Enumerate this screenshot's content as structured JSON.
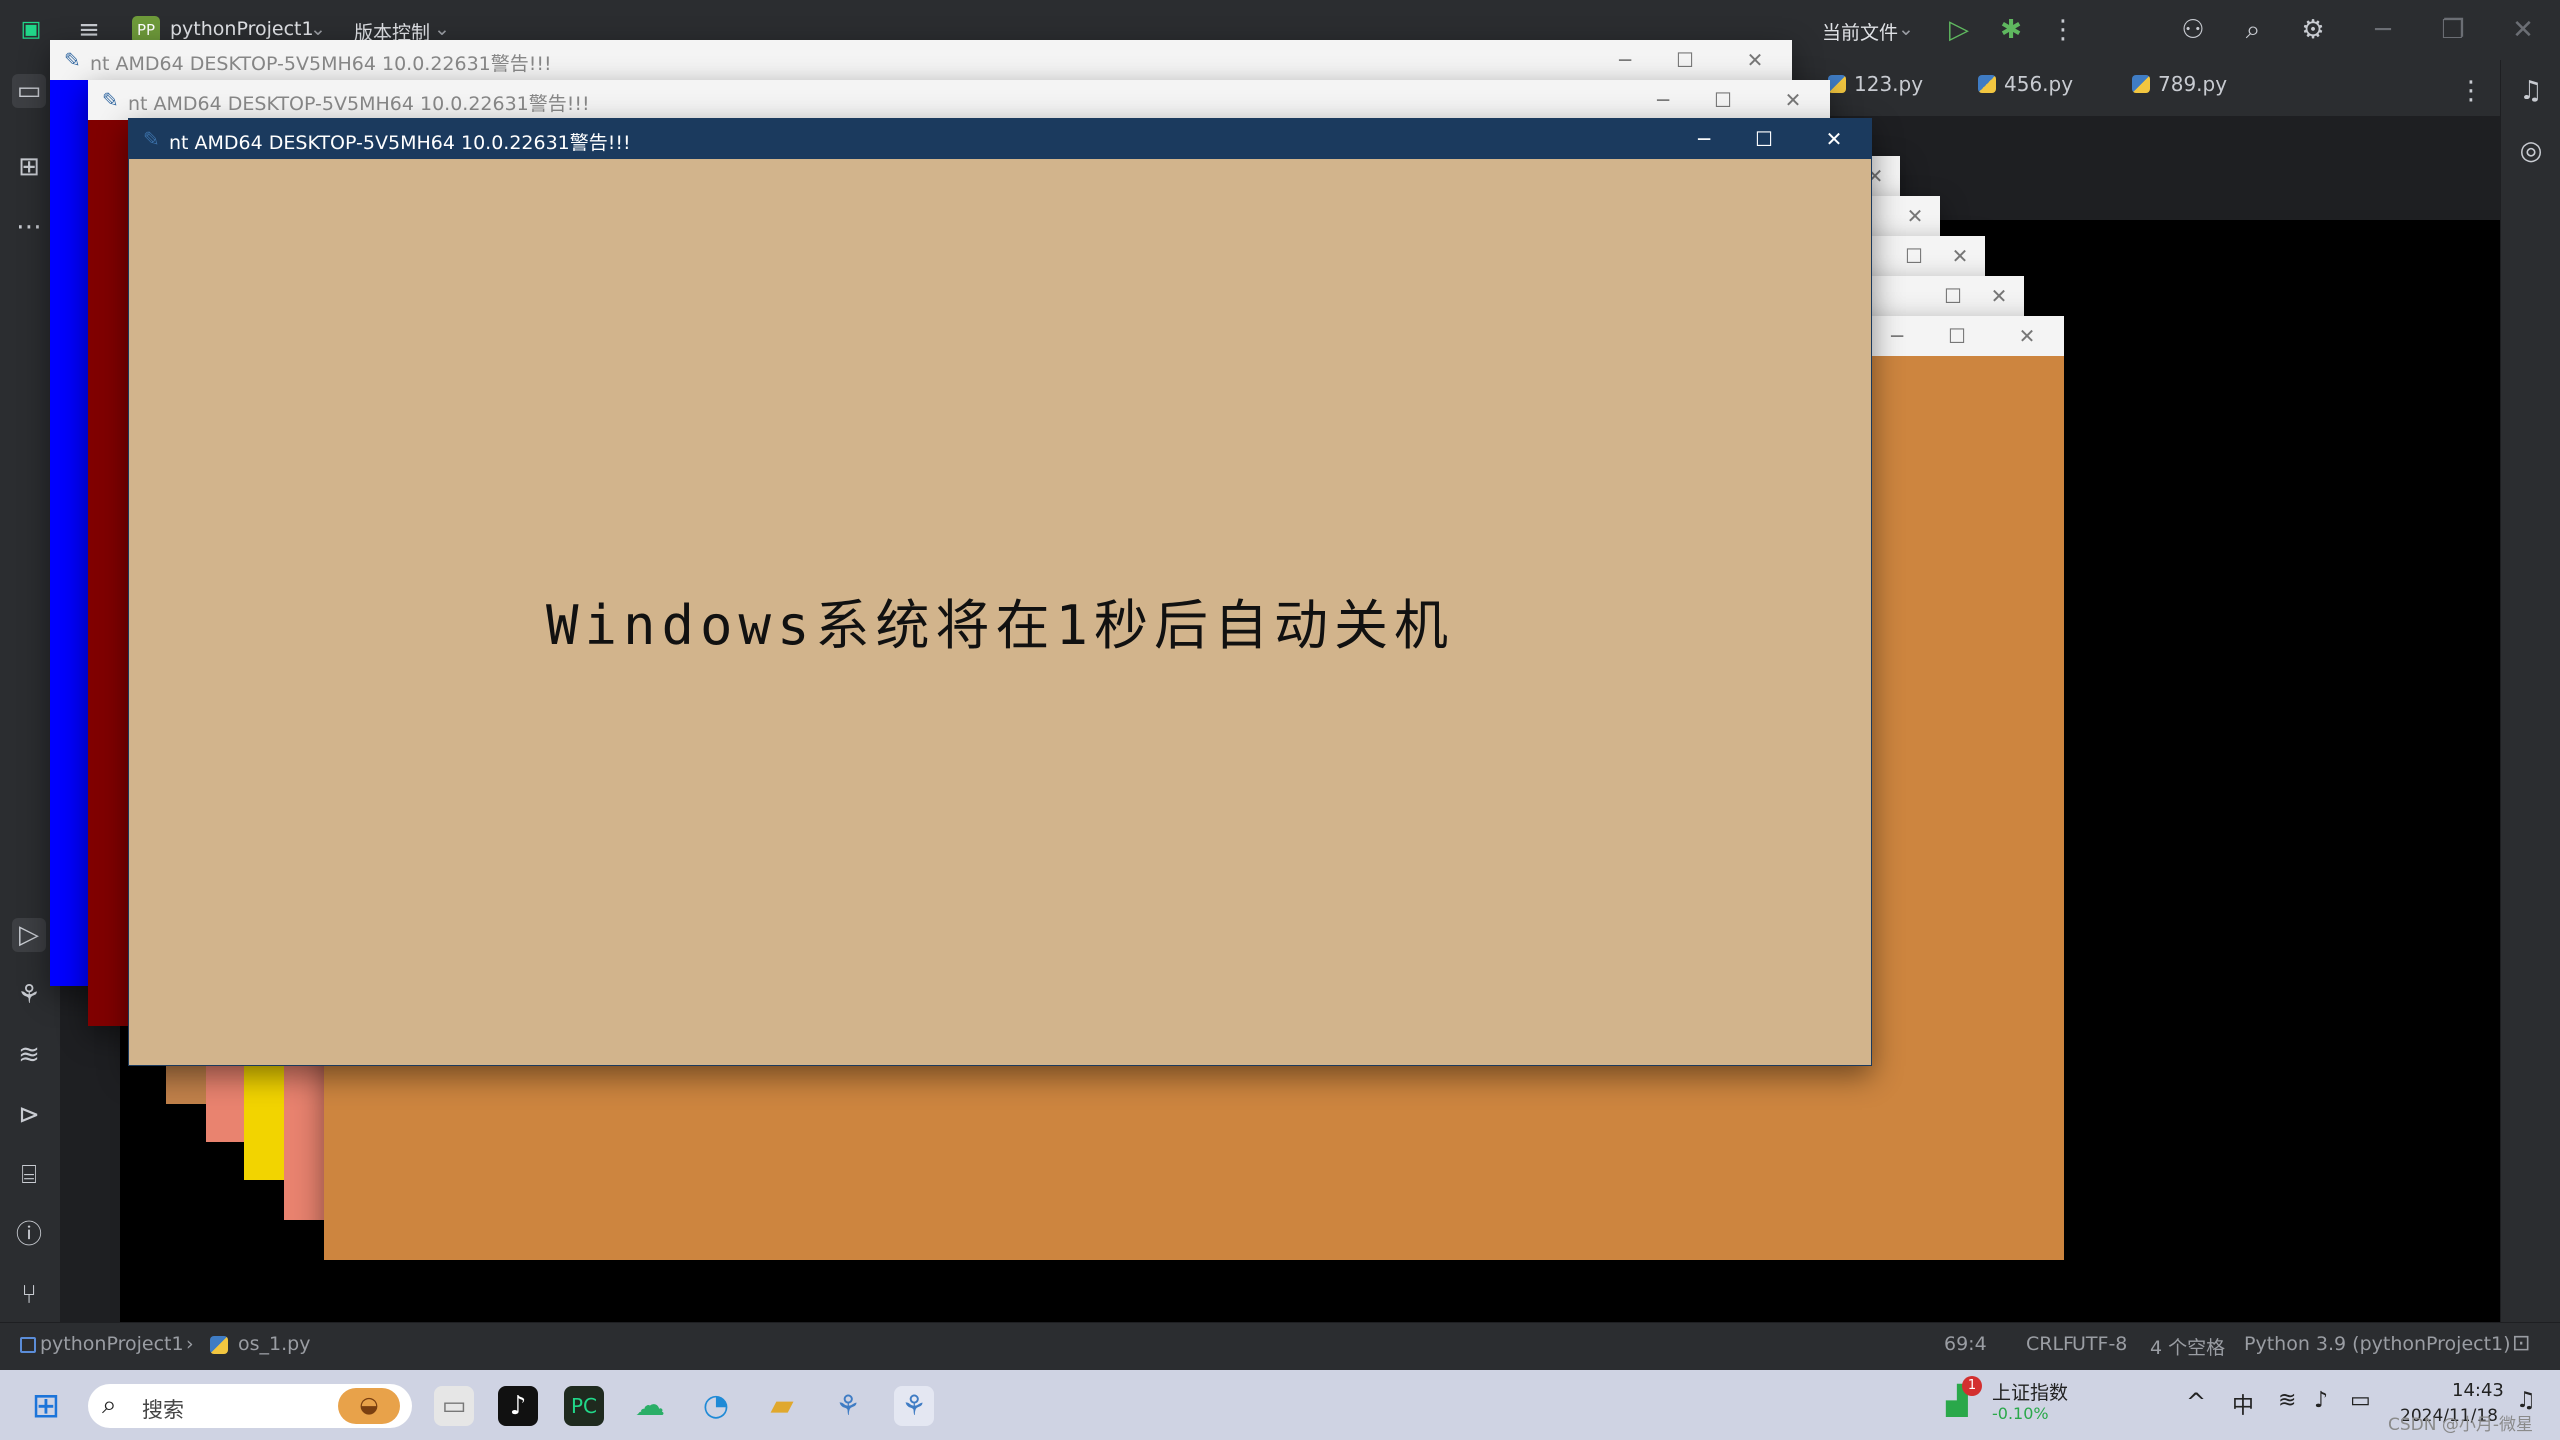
{
  "ide": {
    "project_name": "pythonProject1",
    "project_badge": "PP",
    "vcs_label": "版本控制",
    "run_config": "当前文件",
    "tabs": [
      {
        "label": "123.py"
      },
      {
        "label": "456.py"
      },
      {
        "label": "789.py"
      }
    ],
    "breadcrumb": {
      "project": "pythonProject1",
      "file": "os_1.py"
    },
    "status": {
      "position": "69:4",
      "line_sep": "CRLF",
      "encoding": "UTF-8",
      "indent": "4 个空格",
      "interpreter": "Python 3.9 (pythonProject1)"
    }
  },
  "popup": {
    "title": "nt AMD64 DESKTOP-5V5MH64 10.0.22631警告!!!",
    "message": "Windows系统将在1秒后自动关机",
    "minimize": "─",
    "maximize": "☐",
    "close": "✕",
    "colors": {
      "active_bg": "#d2b48c",
      "blue": "#0000ff",
      "darkred": "#800000",
      "orange": "#cd853f",
      "salmon": "#e9836f",
      "yellow": "#f2d400",
      "peru": "#c1814a"
    }
  },
  "taskbar": {
    "search_placeholder": "搜索",
    "stock_name": "上证指数",
    "stock_change": "-0.10%",
    "stock_badge": "1",
    "ime": "中",
    "time": "14:43",
    "date": "2024/11/18",
    "watermark": "CSDN @小月-微星"
  }
}
